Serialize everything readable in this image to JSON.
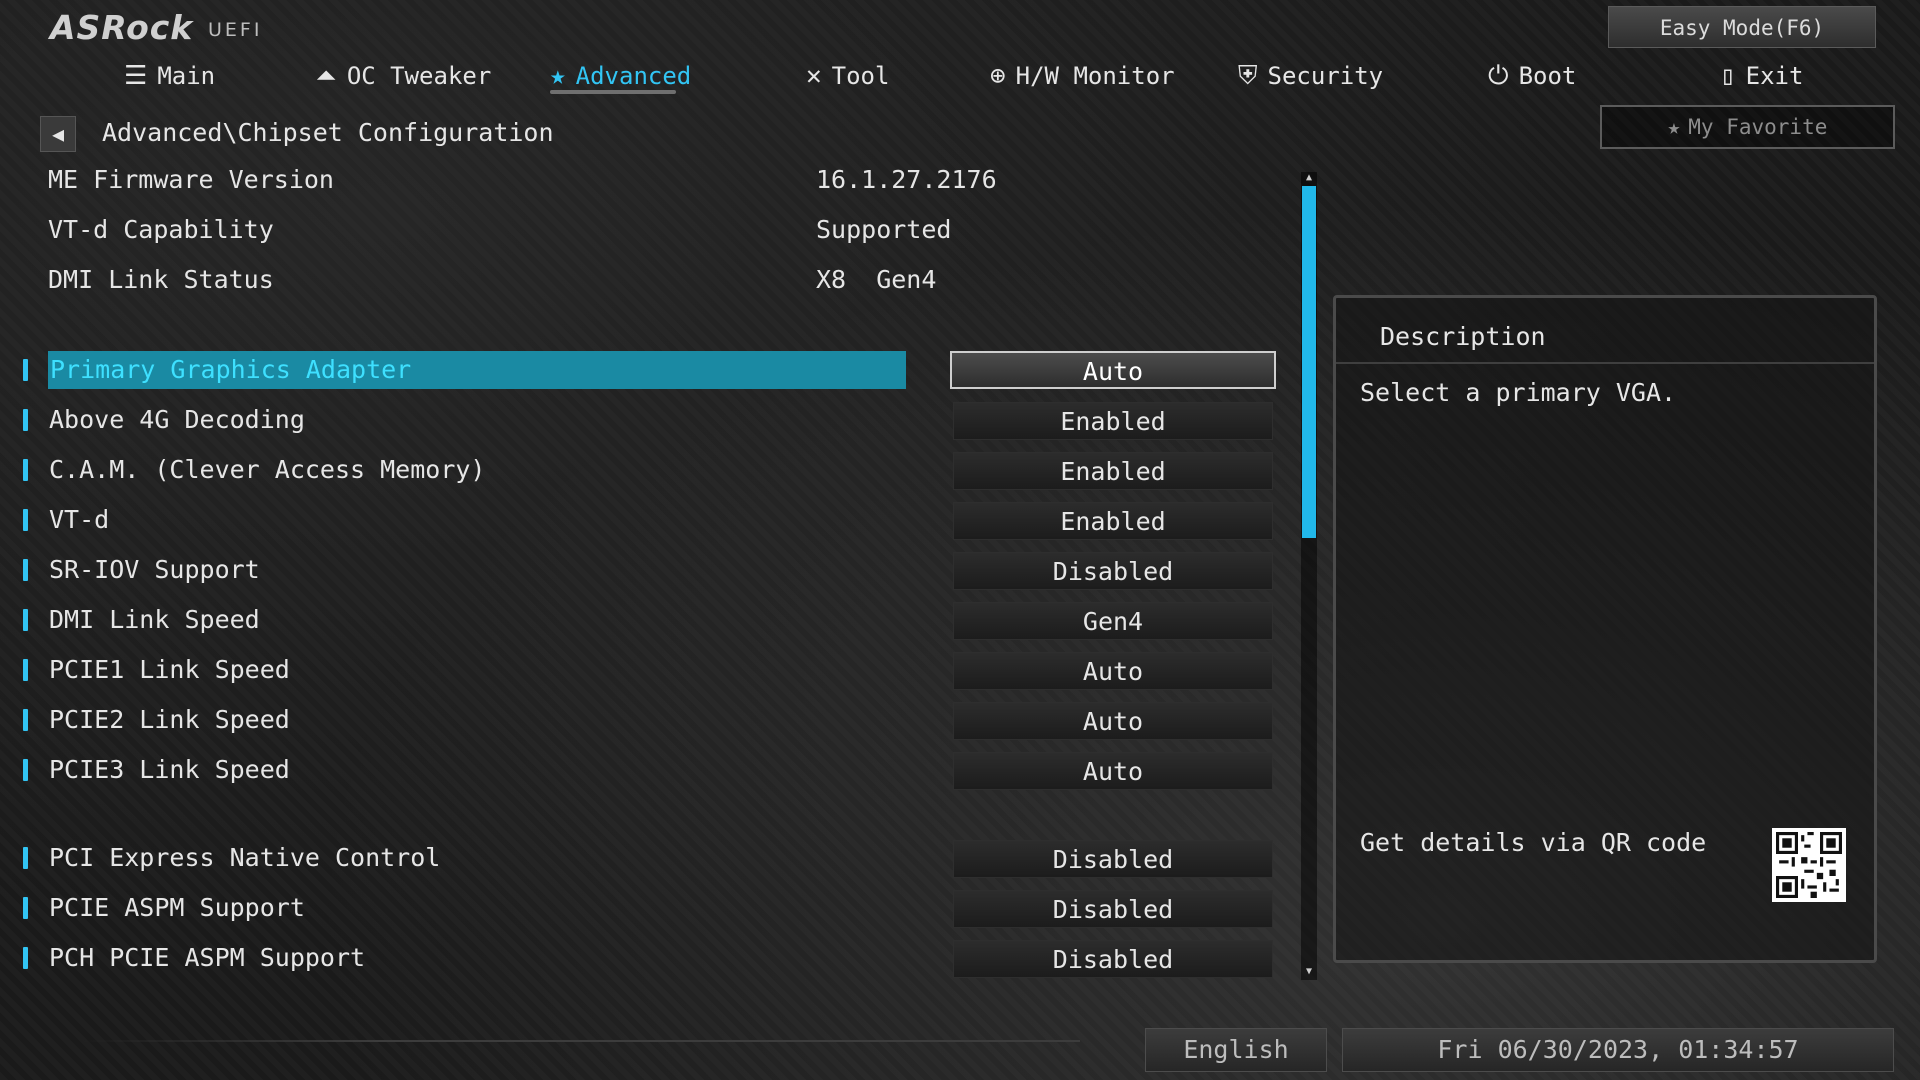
{
  "app": {
    "brand": "ASRock",
    "brand_sub": "UEFI",
    "easy_mode_label": "Easy Mode(F6)",
    "favorite_label": "My Favorite"
  },
  "tabs": [
    {
      "label": "Main",
      "icon": "list-icon",
      "glyph": "☰"
    },
    {
      "label": "OC Tweaker",
      "icon": "rocket-icon",
      "glyph": "🚀"
    },
    {
      "label": "Advanced",
      "icon": "star-icon",
      "glyph": "★",
      "active": true
    },
    {
      "label": "Tool",
      "icon": "tools-icon",
      "glyph": "✕"
    },
    {
      "label": "H/W Monitor",
      "icon": "crosshair-icon",
      "glyph": "⊕"
    },
    {
      "label": "Security",
      "icon": "shield-icon",
      "glyph": "⛨"
    },
    {
      "label": "Boot",
      "icon": "power-icon",
      "glyph": "⏻"
    },
    {
      "label": "Exit",
      "icon": "exit-door-icon",
      "glyph": "▯"
    }
  ],
  "breadcrumb": "Advanced\\Chipset Configuration",
  "info": [
    {
      "label": "ME Firmware Version",
      "value": "16.1.27.2176"
    },
    {
      "label": "VT-d Capability",
      "value": "Supported"
    },
    {
      "label": "DMI Link Status",
      "value": "X8  Gen4"
    }
  ],
  "settings": [
    {
      "label": "Primary Graphics Adapter",
      "value": "Auto",
      "selected": true
    },
    {
      "label": "Above 4G Decoding",
      "value": "Enabled"
    },
    {
      "label": "C.A.M. (Clever Access Memory)",
      "value": "Enabled"
    },
    {
      "label": "VT-d",
      "value": "Enabled"
    },
    {
      "label": "SR-IOV Support",
      "value": "Disabled"
    },
    {
      "label": "DMI Link Speed",
      "value": "Gen4"
    },
    {
      "label": "PCIE1 Link Speed",
      "value": "Auto"
    },
    {
      "label": "PCIE2 Link Speed",
      "value": "Auto"
    },
    {
      "label": "PCIE3 Link Speed",
      "value": "Auto"
    },
    {
      "label": "PCI Express Native Control",
      "value": "Disabled"
    },
    {
      "label": "PCIE ASPM Support",
      "value": "Disabled"
    },
    {
      "label": "PCH PCIE ASPM Support",
      "value": "Disabled"
    }
  ],
  "description": {
    "title": "Description",
    "text": "Select a primary VGA.",
    "qr_text": "Get details via QR code"
  },
  "footer": {
    "language": "English",
    "datetime": "Fri 06/30/2023, 01:34:57"
  },
  "colors": {
    "accent": "#32c5f4",
    "selected_row": "#1a8aa3"
  }
}
